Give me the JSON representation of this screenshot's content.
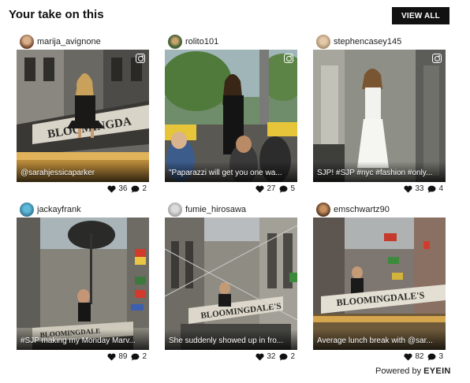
{
  "header": {
    "title": "Your take on this",
    "view_all_label": "VIEW ALL"
  },
  "posts": [
    {
      "username": "marija_avignone",
      "caption": "@sarahjessicaparker",
      "likes": "36",
      "comments": "2"
    },
    {
      "username": "rolito101",
      "caption": "\"Paparazzi will get you one wa...",
      "likes": "27",
      "comments": "5"
    },
    {
      "username": "stephencasey145",
      "caption": "SJP! #SJP #nyc #fashion #only...",
      "likes": "33",
      "comments": "4"
    },
    {
      "username": "jackayfrank",
      "caption": "#SJP making my Monday Marv...",
      "likes": "89",
      "comments": "2"
    },
    {
      "username": "fumie_hirosawa",
      "caption": "She suddenly showed up in fro...",
      "likes": "32",
      "comments": "2"
    },
    {
      "username": "emschwartz90",
      "caption": "Average lunch break with @sar...",
      "likes": "82",
      "comments": "3"
    }
  ],
  "footer": {
    "powered_prefix": "Powered by ",
    "brand": "EYEIN"
  },
  "icons": {
    "photo_badge": "instagram-icon",
    "likes": "heart-icon",
    "comments": "comment-icon"
  }
}
